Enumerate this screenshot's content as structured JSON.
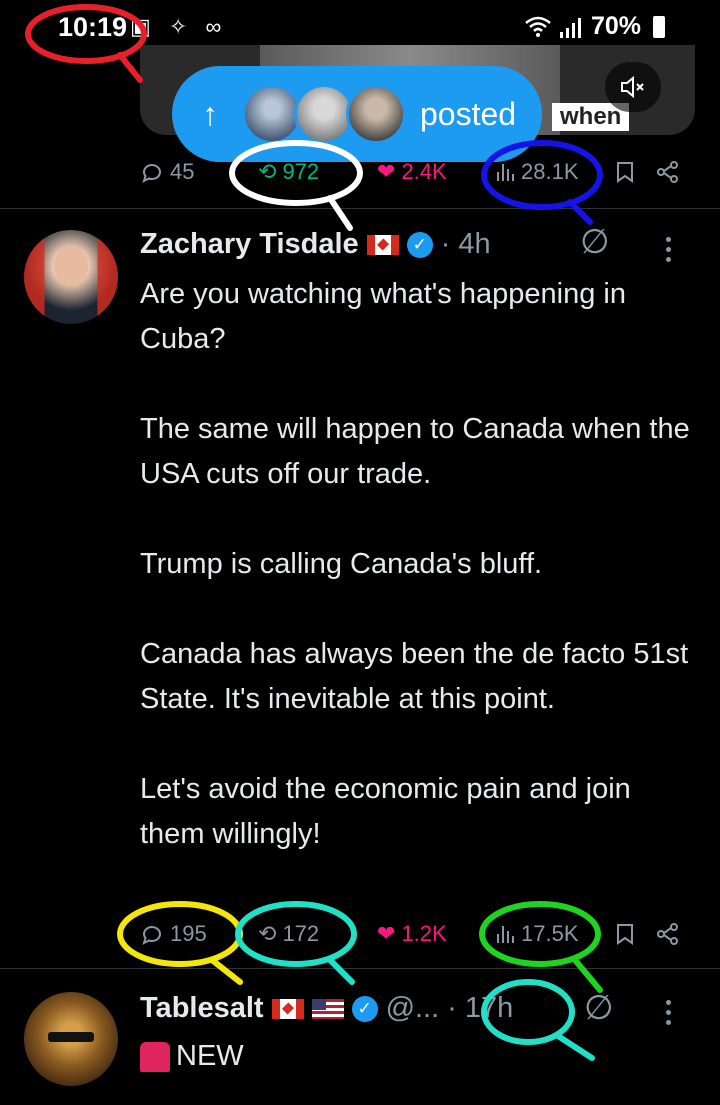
{
  "status_bar": {
    "time": "10:19",
    "battery": "70%"
  },
  "media": {
    "caption": "when"
  },
  "posted_pill": {
    "label": "posted"
  },
  "post_top_actions": {
    "replies": "45",
    "reposts": "972",
    "likes": "2.4K",
    "views": "28.1K"
  },
  "post1": {
    "name": "Zachary Tisdale",
    "time": "· 4h",
    "paragraphs": [
      "Are you watching what's happening in Cuba?",
      "The same will happen to Canada when the USA cuts off our trade.",
      "Trump is calling Canada's bluff.",
      "Canada has always been the de facto 51st State. It's inevitable at this point.",
      "Let's avoid the economic pain and join them willingly!"
    ],
    "actions": {
      "replies": "195",
      "reposts": "172",
      "likes": "1.2K",
      "views": "17.5K"
    }
  },
  "post2": {
    "name": "Tablesalt",
    "handle": "@...",
    "time": "· 17h",
    "text": "NEW"
  },
  "colors": {
    "accent": "#1d9bf0",
    "like": "#f91880",
    "repost": "#00ba7c",
    "muted": "#8b98a5"
  },
  "icons": [
    "reply-icon",
    "repost-icon",
    "heart-icon",
    "views-icon",
    "bookmark-icon",
    "share-icon",
    "verified-icon",
    "grok-icon",
    "more-icon",
    "siren-icon",
    "mute-icon"
  ]
}
